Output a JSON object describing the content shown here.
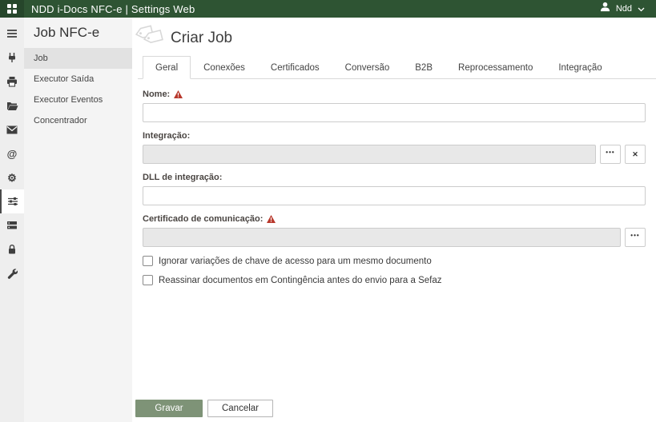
{
  "topbar": {
    "title": "NDD i-Docs NFC-e | Settings Web",
    "user": "Ndd"
  },
  "rail": {
    "icons": [
      "menu-icon",
      "plug-icon",
      "printer-icon",
      "folder-icon",
      "mail-icon",
      "at-icon",
      "gear-icon",
      "sliders-icon",
      "server-icon",
      "lock-icon",
      "wrench-icon"
    ],
    "selected": "sliders-icon",
    "at_glyph": "@",
    "gear_glyph": "⚙"
  },
  "sidebar": {
    "title": "Job NFC-e",
    "items": [
      {
        "label": "Job",
        "selected": true
      },
      {
        "label": "Executor Saída",
        "selected": false
      },
      {
        "label": "Executor Eventos",
        "selected": false
      },
      {
        "label": "Concentrador",
        "selected": false
      }
    ]
  },
  "main": {
    "title": "Criar Job",
    "tabs": [
      {
        "label": "Geral",
        "active": true
      },
      {
        "label": "Conexões",
        "active": false
      },
      {
        "label": "Certificados",
        "active": false
      },
      {
        "label": "Conversão",
        "active": false
      },
      {
        "label": "B2B",
        "active": false
      },
      {
        "label": "Reprocessamento",
        "active": false
      },
      {
        "label": "Integração",
        "active": false
      }
    ],
    "form": {
      "nome": {
        "label": "Nome:",
        "value": "",
        "required": true
      },
      "integracao": {
        "label": "Integração:",
        "value": "",
        "disabled": true,
        "browse_label": "•••",
        "clear_label": "✕"
      },
      "dll": {
        "label": "DLL de integração:",
        "value": ""
      },
      "certificado": {
        "label": "Certificado de comunicação:",
        "value": "",
        "disabled": true,
        "required": true,
        "browse_label": "•••"
      },
      "checkboxes": [
        {
          "label": "Ignorar variações de chave de acesso para um mesmo documento",
          "checked": false
        },
        {
          "label": "Reassinar documentos em Contingência antes do envio para a Sefaz",
          "checked": false
        }
      ]
    },
    "actions": {
      "save": "Gravar",
      "cancel": "Cancelar"
    }
  },
  "colors": {
    "topbar_green": "#2e5433",
    "save_button_green": "#7e9377",
    "warning_red": "#b8382c",
    "disabled_input_gray": "#e8e8e8"
  }
}
